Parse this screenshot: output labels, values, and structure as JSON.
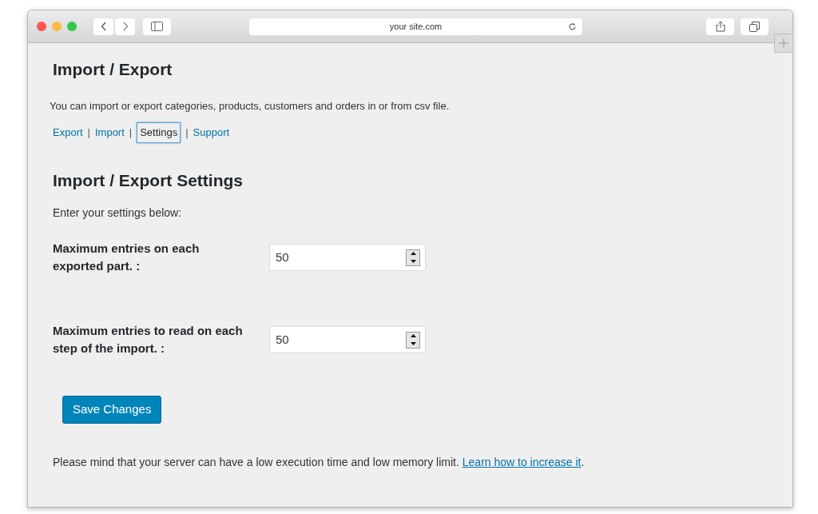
{
  "browser": {
    "address": "your site.com"
  },
  "page": {
    "title": "Import / Export",
    "intro": "You can import or export categories, products, customers and orders in or from csv file.",
    "nav_separator": "|",
    "tabs": [
      {
        "label": "Export",
        "selected": false
      },
      {
        "label": "Import",
        "selected": false
      },
      {
        "label": "Settings",
        "selected": true
      },
      {
        "label": "Support",
        "selected": false
      }
    ],
    "section_title": "Import / Export Settings",
    "section_intro": "Enter your settings below:",
    "fields": [
      {
        "label": "Maximum entries on each exported part. :",
        "value": "50"
      },
      {
        "label": "Maximum entries to read on each step of the import. :",
        "value": "50"
      }
    ],
    "save_button": "Save Changes",
    "notice": {
      "text": "Please mind that your server can have a low execution time and low memory limit.",
      "link": "Learn how to increase it",
      "after": "."
    }
  }
}
